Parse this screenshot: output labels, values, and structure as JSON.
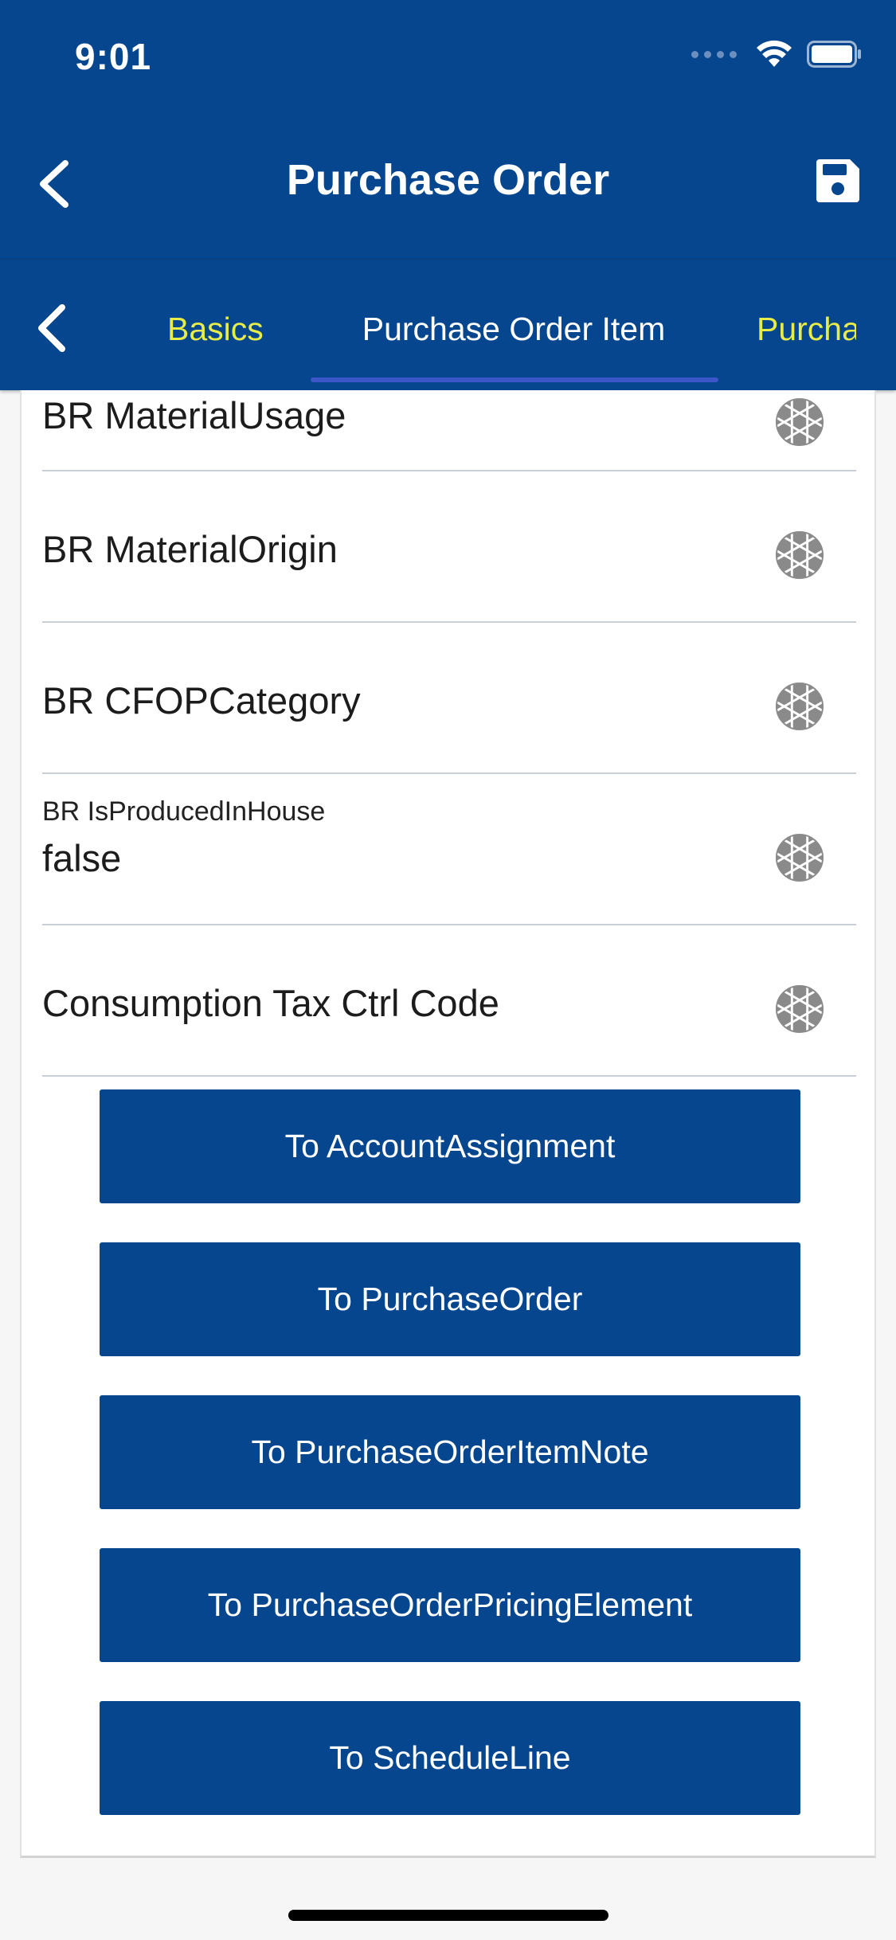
{
  "status": {
    "time": "9:01"
  },
  "nav": {
    "title": "Purchase Order"
  },
  "tabs": [
    {
      "label": "Basics",
      "active": false
    },
    {
      "label": "Purchase Order Item",
      "active": true
    },
    {
      "label": "Purcha",
      "active": false
    }
  ],
  "fields": [
    {
      "label": "BR MaterialUsage",
      "value": ""
    },
    {
      "label": "BR MaterialOrigin",
      "value": ""
    },
    {
      "label": "BR CFOPCategory",
      "value": ""
    },
    {
      "label": "BR IsProducedInHouse",
      "value": "false"
    },
    {
      "label": "Consumption Tax Ctrl Code",
      "value": ""
    }
  ],
  "buttons": [
    {
      "label": "To AccountAssignment"
    },
    {
      "label": "To PurchaseOrder"
    },
    {
      "label": "To PurchaseOrderItemNote"
    },
    {
      "label": "To PurchaseOrderPricingElement"
    },
    {
      "label": "To ScheduleLine"
    }
  ],
  "colors": {
    "brand": "#05468f",
    "tab_inactive": "#e8ec4a",
    "tab_underline": "#3c55c8"
  },
  "icons": {
    "back": "chevron-left-icon",
    "save": "floppy-disk-icon",
    "field_action": "aperture-icon",
    "wifi": "wifi-icon",
    "battery": "battery-icon"
  }
}
